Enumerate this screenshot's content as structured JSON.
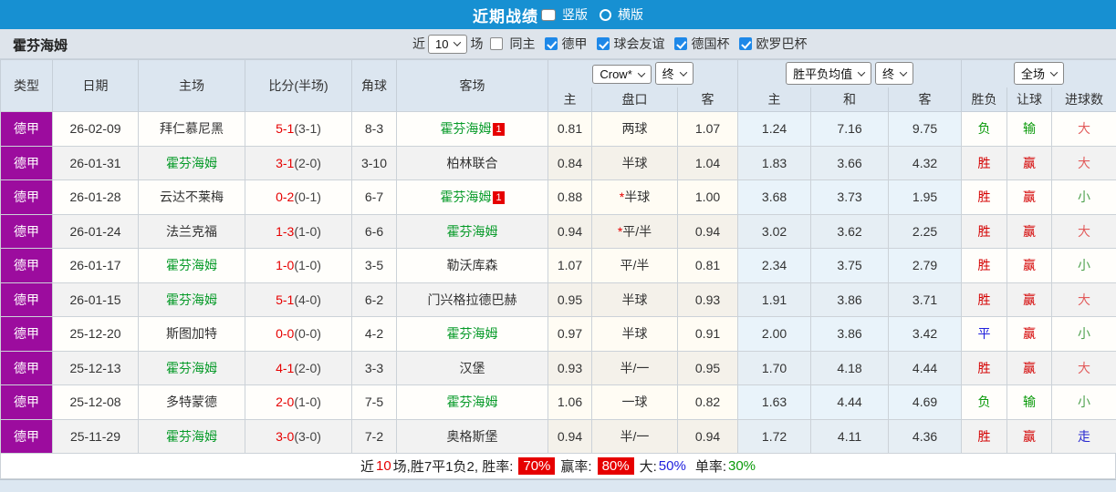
{
  "top_bar": {
    "title": "近期战绩",
    "radio_vertical": "竖版",
    "radio_horizontal": "横版"
  },
  "filter_bar": {
    "team": "霍芬海姆",
    "near_label": "近",
    "match_count": "10",
    "games_label": "场",
    "checkboxes": [
      {
        "label": "同主",
        "checked": false
      },
      {
        "label": "德甲",
        "checked": true
      },
      {
        "label": "球会友谊",
        "checked": true
      },
      {
        "label": "德国杯",
        "checked": true
      },
      {
        "label": "欧罗巴杯",
        "checked": true
      }
    ]
  },
  "table": {
    "headers": {
      "type": "类型",
      "date": "日期",
      "home": "主场",
      "score": "比分(半场)",
      "corner": "角球",
      "away": "客场",
      "odds_select": "Crow*",
      "odds_final_select": "终",
      "avg_select": "胜平负均值",
      "avg_final_select": "终",
      "scope_select": "全场",
      "odds_home": "主",
      "odds_line": "盘口",
      "odds_away": "客",
      "avg_home": "主",
      "avg_draw": "和",
      "avg_away": "客",
      "result": "胜负",
      "handicap": "让球",
      "goals": "进球数"
    },
    "rows": [
      {
        "league": "德甲",
        "date": "26-02-09",
        "home": "拜仁慕尼黑",
        "score": "5-1",
        "half": "(3-1)",
        "corner": "8-3",
        "away": "霍芬海姆",
        "away_badge": "1",
        "odds_home": "0.81",
        "line_prefix": "",
        "line": "两球",
        "odds_away": "1.07",
        "avg_home": "1.24",
        "avg_draw": "7.16",
        "avg_away": "9.75",
        "result": "负",
        "handicap": "输",
        "goals": "大"
      },
      {
        "league": "德甲",
        "date": "26-01-31",
        "home": "霍芬海姆",
        "score": "3-1",
        "half": "(2-0)",
        "corner": "3-10",
        "away": "柏林联合",
        "away_badge": "",
        "odds_home": "0.84",
        "line_prefix": "",
        "line": "半球",
        "odds_away": "1.04",
        "avg_home": "1.83",
        "avg_draw": "3.66",
        "avg_away": "4.32",
        "result": "胜",
        "handicap": "赢",
        "goals": "大"
      },
      {
        "league": "德甲",
        "date": "26-01-28",
        "home": "云达不莱梅",
        "score": "0-2",
        "half": "(0-1)",
        "corner": "6-7",
        "away": "霍芬海姆",
        "away_badge": "1",
        "odds_home": "0.88",
        "line_prefix": "*",
        "line": "半球",
        "odds_away": "1.00",
        "avg_home": "3.68",
        "avg_draw": "3.73",
        "avg_away": "1.95",
        "result": "胜",
        "handicap": "赢",
        "goals": "小"
      },
      {
        "league": "德甲",
        "date": "26-01-24",
        "home": "法兰克福",
        "score": "1-3",
        "half": "(1-0)",
        "corner": "6-6",
        "away": "霍芬海姆",
        "away_badge": "",
        "odds_home": "0.94",
        "line_prefix": "*",
        "line": "平/半",
        "odds_away": "0.94",
        "avg_home": "3.02",
        "avg_draw": "3.62",
        "avg_away": "2.25",
        "result": "胜",
        "handicap": "赢",
        "goals": "大"
      },
      {
        "league": "德甲",
        "date": "26-01-17",
        "home": "霍芬海姆",
        "score": "1-0",
        "half": "(1-0)",
        "corner": "3-5",
        "away": "勒沃库森",
        "away_badge": "",
        "odds_home": "1.07",
        "line_prefix": "",
        "line": "平/半",
        "odds_away": "0.81",
        "avg_home": "2.34",
        "avg_draw": "3.75",
        "avg_away": "2.79",
        "result": "胜",
        "handicap": "赢",
        "goals": "小"
      },
      {
        "league": "德甲",
        "date": "26-01-15",
        "home": "霍芬海姆",
        "score": "5-1",
        "half": "(4-0)",
        "corner": "6-2",
        "away": "门兴格拉德巴赫",
        "away_badge": "",
        "odds_home": "0.95",
        "line_prefix": "",
        "line": "半球",
        "odds_away": "0.93",
        "avg_home": "1.91",
        "avg_draw": "3.86",
        "avg_away": "3.71",
        "result": "胜",
        "handicap": "赢",
        "goals": "大"
      },
      {
        "league": "德甲",
        "date": "25-12-20",
        "home": "斯图加特",
        "score": "0-0",
        "half": "(0-0)",
        "corner": "4-2",
        "away": "霍芬海姆",
        "away_badge": "",
        "odds_home": "0.97",
        "line_prefix": "",
        "line": "半球",
        "odds_away": "0.91",
        "avg_home": "2.00",
        "avg_draw": "3.86",
        "avg_away": "3.42",
        "result": "平",
        "handicap": "赢",
        "goals": "小"
      },
      {
        "league": "德甲",
        "date": "25-12-13",
        "home": "霍芬海姆",
        "score": "4-1",
        "half": "(2-0)",
        "corner": "3-3",
        "away": "汉堡",
        "away_badge": "",
        "odds_home": "0.93",
        "line_prefix": "",
        "line": "半/一",
        "odds_away": "0.95",
        "avg_home": "1.70",
        "avg_draw": "4.18",
        "avg_away": "4.44",
        "result": "胜",
        "handicap": "赢",
        "goals": "大"
      },
      {
        "league": "德甲",
        "date": "25-12-08",
        "home": "多特蒙德",
        "score": "2-0",
        "half": "(1-0)",
        "corner": "7-5",
        "away": "霍芬海姆",
        "away_badge": "",
        "odds_home": "1.06",
        "line_prefix": "",
        "line": "一球",
        "odds_away": "0.82",
        "avg_home": "1.63",
        "avg_draw": "4.44",
        "avg_away": "4.69",
        "result": "负",
        "handicap": "输",
        "goals": "小"
      },
      {
        "league": "德甲",
        "date": "25-11-29",
        "home": "霍芬海姆",
        "score": "3-0",
        "half": "(3-0)",
        "corner": "7-2",
        "away": "奥格斯堡",
        "away_badge": "",
        "odds_home": "0.94",
        "line_prefix": "",
        "line": "半/一",
        "odds_away": "0.94",
        "avg_home": "1.72",
        "avg_draw": "4.11",
        "avg_away": "4.36",
        "result": "胜",
        "handicap": "赢",
        "goals": "走"
      }
    ]
  },
  "footer": {
    "prefix": "近",
    "count": "10",
    "mid": "场,胜7平1负2, 胜率:",
    "win_rate": "70%",
    "win_label": "赢率:",
    "win_odds_rate": "80%",
    "big_label": "大:",
    "big_rate": "50%",
    "single_label": "单率:",
    "single_rate": "30%"
  },
  "colors": {
    "topbar_blue": "#1790d2",
    "league_purple": "#9c0c9e",
    "team_green": "#089b2a",
    "score_red": "#e60000",
    "badge_red": "#e60000",
    "checkbox_blue": "#1e88e8"
  }
}
